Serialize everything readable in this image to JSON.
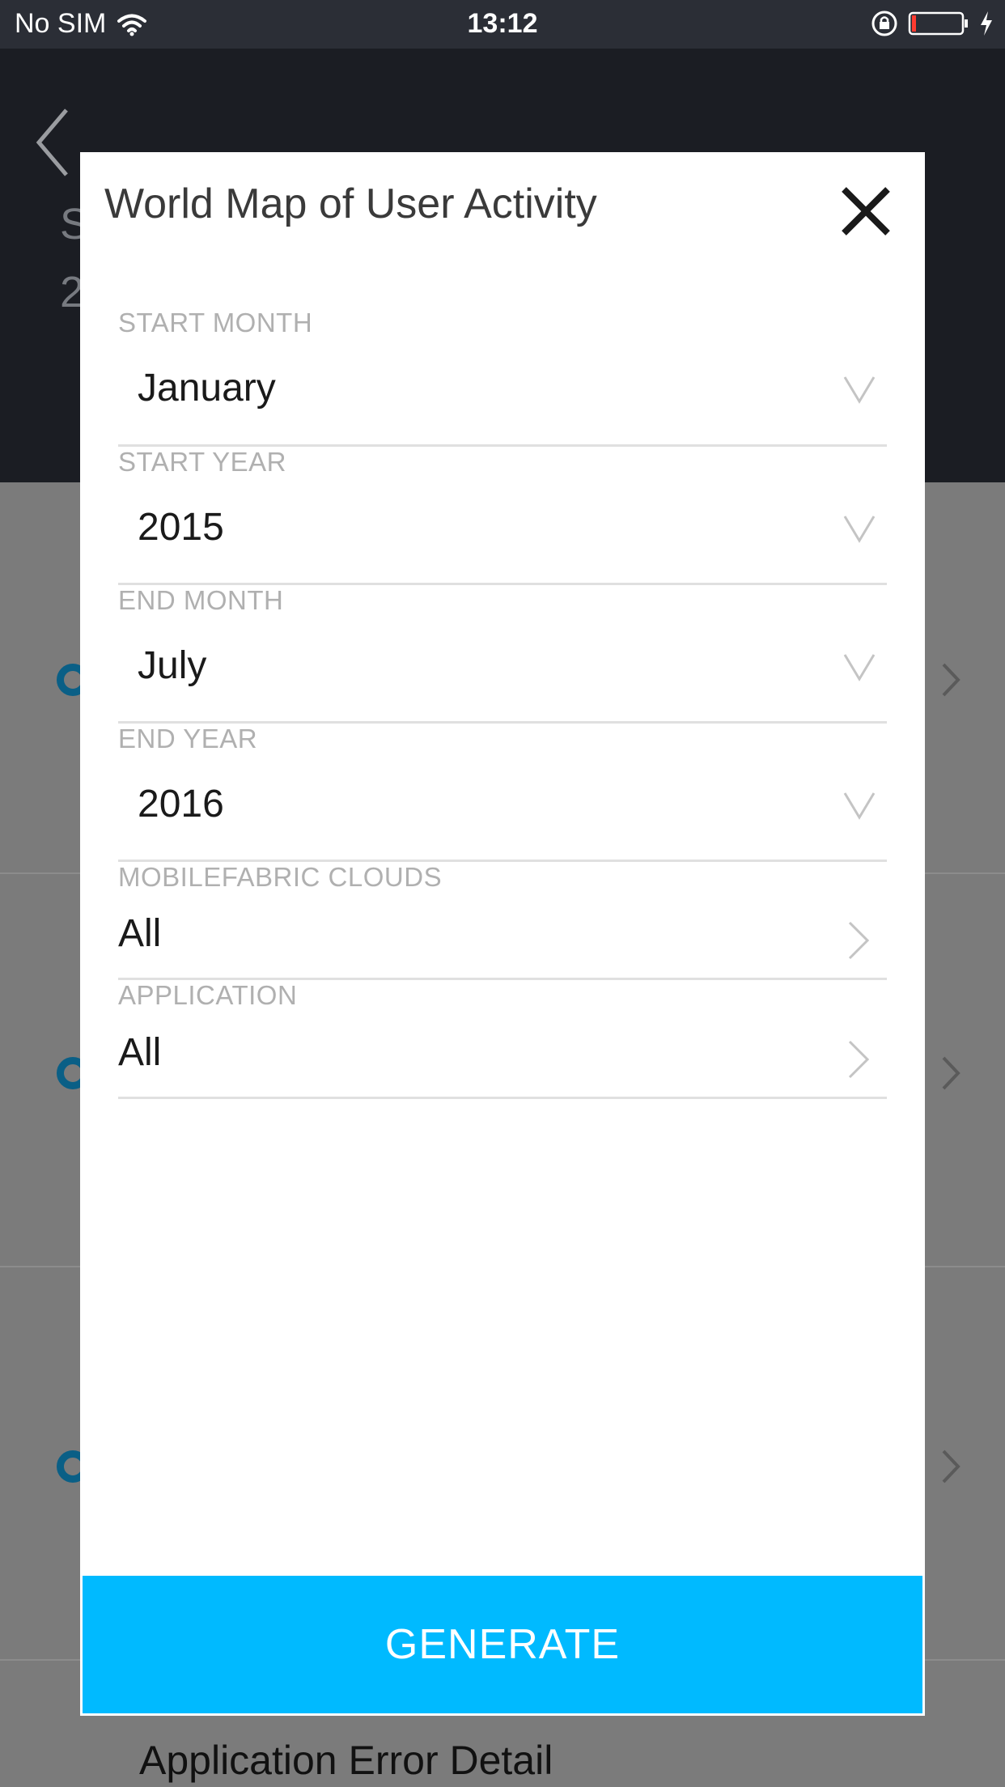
{
  "status_bar": {
    "carrier": "No SIM",
    "time": "13:12"
  },
  "background": {
    "header_line1": "S",
    "header_line2": "2",
    "bottom_item": "Application Error Detail"
  },
  "modal": {
    "title": "World Map of User Activity",
    "fields": [
      {
        "label": "START MONTH",
        "value": "January",
        "control": "dropdown"
      },
      {
        "label": "START YEAR",
        "value": "2015",
        "control": "dropdown"
      },
      {
        "label": "END MONTH",
        "value": "July",
        "control": "dropdown"
      },
      {
        "label": "END YEAR",
        "value": "2016",
        "control": "dropdown"
      },
      {
        "label": "MOBILEFABRIC CLOUDS",
        "value": "All",
        "control": "navigate"
      },
      {
        "label": "APPLICATION",
        "value": "All",
        "control": "navigate"
      }
    ],
    "generate_label": "GENERATE"
  },
  "colors": {
    "accent": "#00baff",
    "header_bg": "#1b1d23",
    "overlay": "#7b7b7b"
  },
  "icons": [
    "wifi-icon",
    "orientation-lock-icon",
    "battery-icon",
    "charging-icon",
    "back-icon",
    "close-icon",
    "chevron-down-icon",
    "chevron-right-icon"
  ]
}
